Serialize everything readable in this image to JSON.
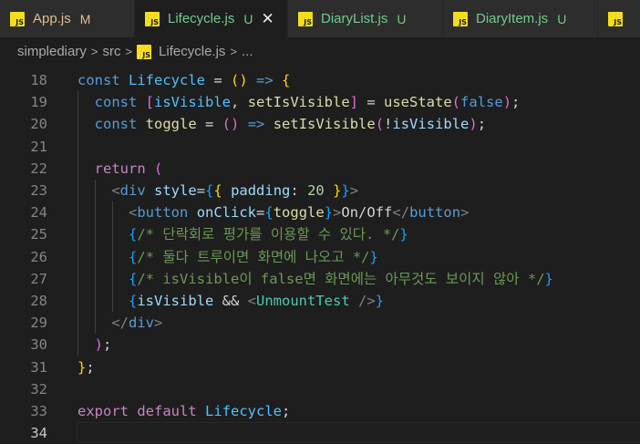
{
  "tabs": [
    {
      "name": "App.js",
      "status": "M",
      "status_kind": "modified",
      "active": false
    },
    {
      "name": "Lifecycle.js",
      "status": "U",
      "status_kind": "untracked",
      "active": true,
      "close": "✕"
    },
    {
      "name": "DiaryList.js",
      "status": "U",
      "status_kind": "untracked",
      "active": false
    },
    {
      "name": "DiaryItem.js",
      "status": "U",
      "status_kind": "untracked",
      "active": false
    }
  ],
  "tab_icon_text": "JS",
  "breadcrumb": {
    "items": [
      "simplediary",
      "src",
      "Lifecycle.js",
      "..."
    ],
    "separator": ">"
  },
  "editor": {
    "current_line": 34,
    "lines": [
      {
        "n": "18",
        "tokens": [
          [
            "kw",
            "const "
          ],
          [
            "cst",
            "Lifecycle"
          ],
          [
            "txt",
            " = "
          ],
          [
            "br1",
            "()"
          ],
          [
            "txt",
            " "
          ],
          [
            "kw",
            "=>"
          ],
          [
            "txt",
            " "
          ],
          [
            "br1",
            "{"
          ]
        ]
      },
      {
        "n": "19",
        "tokens": [
          [
            "txt",
            "  "
          ],
          [
            "kw",
            "const "
          ],
          [
            "br2",
            "["
          ],
          [
            "cst",
            "isVisible"
          ],
          [
            "txt",
            ", "
          ],
          [
            "fn",
            "setIsVisible"
          ],
          [
            "br2",
            "]"
          ],
          [
            "txt",
            " = "
          ],
          [
            "fn",
            "useState"
          ],
          [
            "br2",
            "("
          ],
          [
            "kw",
            "false"
          ],
          [
            "br2",
            ")"
          ],
          [
            "txt",
            ";"
          ]
        ]
      },
      {
        "n": "20",
        "tokens": [
          [
            "txt",
            "  "
          ],
          [
            "kw",
            "const "
          ],
          [
            "fn",
            "toggle"
          ],
          [
            "txt",
            " = "
          ],
          [
            "br2",
            "()"
          ],
          [
            "txt",
            " "
          ],
          [
            "kw",
            "=>"
          ],
          [
            "txt",
            " "
          ],
          [
            "fn",
            "setIsVisible"
          ],
          [
            "br2",
            "("
          ],
          [
            "txt",
            "!"
          ],
          [
            "var",
            "isVisible"
          ],
          [
            "br2",
            ")"
          ],
          [
            "txt",
            ";"
          ]
        ]
      },
      {
        "n": "21",
        "tokens": []
      },
      {
        "n": "22",
        "tokens": [
          [
            "txt",
            "  "
          ],
          [
            "kw2",
            "return"
          ],
          [
            "txt",
            " "
          ],
          [
            "br2",
            "("
          ]
        ]
      },
      {
        "n": "23",
        "tokens": [
          [
            "txt",
            "    "
          ],
          [
            "pun",
            "<"
          ],
          [
            "tag",
            "div"
          ],
          [
            "txt",
            " "
          ],
          [
            "attr",
            "style"
          ],
          [
            "txt",
            "="
          ],
          [
            "br3",
            "{"
          ],
          [
            "br1",
            "{"
          ],
          [
            "txt",
            " "
          ],
          [
            "attr",
            "padding"
          ],
          [
            "txt",
            ": "
          ],
          [
            "num",
            "20"
          ],
          [
            "txt",
            " "
          ],
          [
            "br1",
            "}"
          ],
          [
            "br3",
            "}"
          ],
          [
            "pun",
            ">"
          ]
        ]
      },
      {
        "n": "24",
        "tokens": [
          [
            "txt",
            "      "
          ],
          [
            "pun",
            "<"
          ],
          [
            "tag",
            "button"
          ],
          [
            "txt",
            " "
          ],
          [
            "attr",
            "onClick"
          ],
          [
            "txt",
            "="
          ],
          [
            "br3",
            "{"
          ],
          [
            "fn",
            "toggle"
          ],
          [
            "br3",
            "}"
          ],
          [
            "pun",
            ">"
          ],
          [
            "txt",
            "On/Off"
          ],
          [
            "pun",
            "</"
          ],
          [
            "tag",
            "button"
          ],
          [
            "pun",
            ">"
          ]
        ]
      },
      {
        "n": "25",
        "tokens": [
          [
            "txt",
            "      "
          ],
          [
            "br3",
            "{"
          ],
          [
            "com",
            "/* 단락회로 평가를 이용할 수 있다. */"
          ],
          [
            "br3",
            "}"
          ]
        ]
      },
      {
        "n": "26",
        "tokens": [
          [
            "txt",
            "      "
          ],
          [
            "br3",
            "{"
          ],
          [
            "com",
            "/* 둘다 트루이면 화면에 나오고 */"
          ],
          [
            "br3",
            "}"
          ]
        ]
      },
      {
        "n": "27",
        "tokens": [
          [
            "txt",
            "      "
          ],
          [
            "br3",
            "{"
          ],
          [
            "com",
            "/* isVisible이 false면 화면에는 아무것도 보이지 않아 */"
          ],
          [
            "br3",
            "}"
          ]
        ]
      },
      {
        "n": "28",
        "tokens": [
          [
            "txt",
            "      "
          ],
          [
            "br3",
            "{"
          ],
          [
            "var",
            "isVisible"
          ],
          [
            "txt",
            " && "
          ],
          [
            "pun",
            "<"
          ],
          [
            "cmp",
            "UnmountTest"
          ],
          [
            "txt",
            " "
          ],
          [
            "pun",
            "/>"
          ],
          [
            "br3",
            "}"
          ]
        ]
      },
      {
        "n": "29",
        "tokens": [
          [
            "txt",
            "    "
          ],
          [
            "pun",
            "</"
          ],
          [
            "tag",
            "div"
          ],
          [
            "pun",
            ">"
          ]
        ]
      },
      {
        "n": "30",
        "tokens": [
          [
            "txt",
            "  "
          ],
          [
            "br2",
            ")"
          ],
          [
            "txt",
            ";"
          ]
        ]
      },
      {
        "n": "31",
        "tokens": [
          [
            "br1",
            "}"
          ],
          [
            "txt",
            ";"
          ]
        ]
      },
      {
        "n": "32",
        "tokens": []
      },
      {
        "n": "33",
        "tokens": [
          [
            "kw2",
            "export"
          ],
          [
            "txt",
            " "
          ],
          [
            "kw2",
            "default"
          ],
          [
            "txt",
            " "
          ],
          [
            "cst",
            "Lifecycle"
          ],
          [
            "txt",
            ";"
          ]
        ]
      },
      {
        "n": "34",
        "tokens": []
      }
    ]
  }
}
